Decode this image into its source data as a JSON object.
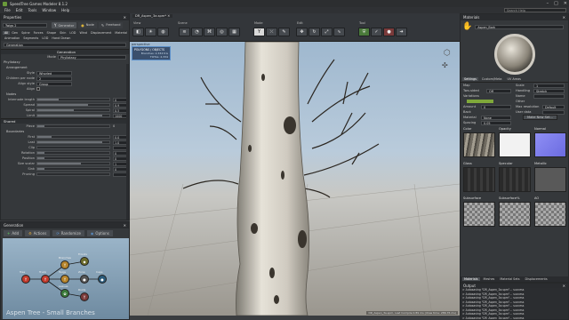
{
  "window": {
    "title": "SpeedTree Games Modeler 8.1.2",
    "controls": [
      "–",
      "□",
      "✕"
    ]
  },
  "menu": [
    "File",
    "Edit",
    "Tools",
    "Window",
    "Help"
  ],
  "help_search": {
    "placeholder": "Search Help"
  },
  "properties": {
    "title": "Properties",
    "node_field": "Twigs 2",
    "mode_tabs": [
      "Generator",
      "Node",
      "Freehand"
    ],
    "tabs_row1": [
      "Gen",
      "Spine",
      "Forces",
      "Shape",
      "Skin",
      "LOD",
      "Wind",
      "Displacement",
      "Material"
    ],
    "tabs_row2": [
      "Animation",
      "Segments",
      "LOD",
      "Hand Drawn"
    ],
    "tab_all": "All",
    "generation_field": "Generation",
    "section_generation": "Generation",
    "mode": {
      "label": "Mode",
      "value": "Phyllotaxy"
    },
    "phyllotaxy_label": "Phyllotaxy",
    "arrangement_label": "Arrangement",
    "style": {
      "label": "Style",
      "value": "Whorled"
    },
    "children_per_node": {
      "label": "Children per node",
      "value": "2"
    },
    "align_style": {
      "label": "Align style",
      "value": "Group"
    },
    "align": {
      "label": "Align"
    },
    "nodes_label": "Nodes",
    "nodes": [
      {
        "label": "Internode length",
        "value": "0",
        "fill": 0.3
      },
      {
        "label": "Spread",
        "value": "0.9",
        "fill": 0.7
      },
      {
        "label": "Spiral",
        "value": "0.5",
        "fill": 0.5
      },
      {
        "label": "Limit",
        "value": "1000",
        "fill": 0.9
      }
    ],
    "shared_label": "Shared",
    "piece": {
      "label": "Piece",
      "value": "0"
    },
    "boundaries_label": "Boundaries",
    "boundaries": [
      {
        "label": "First",
        "value": "0.0",
        "fill": 0.2
      },
      {
        "label": "Last",
        "value": "1.0",
        "fill": 0.9
      },
      {
        "label": "Clip",
        "value": "",
        "fill": 0.0
      }
    ],
    "misc": [
      {
        "label": "Rotation",
        "value": "0",
        "fill": 0.1
      },
      {
        "label": "Position",
        "value": "0",
        "fill": 0.1
      },
      {
        "label": "Size scalar",
        "value": "1",
        "fill": 0.6
      },
      {
        "label": "Sink",
        "value": "0",
        "fill": 0.1
      },
      {
        "label": "Pruning",
        "value": "",
        "fill": 0.0
      }
    ]
  },
  "generation_panel": {
    "title": "Generation",
    "buttons": [
      "Add",
      "Actions",
      "Randomize",
      "Options"
    ],
    "caption": "Aspen Tree - Small Branches",
    "nodes": [
      {
        "label": "Tree",
        "icon": "Y",
        "color": "#c0392b"
      },
      {
        "label": "Trunk",
        "icon": "Y",
        "color": "#c0392b"
      },
      {
        "label": "Branches",
        "icon": "Y",
        "color": "#b5832a"
      },
      {
        "label": "Twigs",
        "icon": "Y",
        "color": "#b5832a"
      },
      {
        "label": "Leaves",
        "icon": "✿",
        "color": "#3a7a3a"
      },
      {
        "label": "Fronds",
        "icon": "◆",
        "color": "#6a6a2a"
      },
      {
        "label": "Zone",
        "icon": "●",
        "color": "#555"
      },
      {
        "label": "Roots",
        "icon": "Y",
        "color": "#7a3a3a"
      },
      {
        "label": "Caps",
        "icon": "●",
        "color": "#2a5a7a"
      }
    ]
  },
  "toolbar": {
    "groups": [
      "View",
      "Scene",
      "Mode",
      "Edit",
      "Tool"
    ],
    "tab_name": "DR_Aspen_3a.spm*"
  },
  "viewport": {
    "label": "perspective",
    "stats_title": "POLYGONS / OBJECTS",
    "stats_lines": [
      "Branches: 2,334 tris",
      "TOTAL: 2,334"
    ],
    "status": "DR_Aspen_3a.spm, Last Compile 0.89 ms (draw time: 286.76 ms)"
  },
  "materials": {
    "title": "Materials",
    "selected": "Aspen_Bark",
    "tabs": [
      "Settings",
      "Custom/Meta",
      "UV Areas"
    ],
    "map_label": "Map",
    "two_sided": {
      "label": "Two-sided",
      "value": "Off"
    },
    "variations_label": "Variations",
    "amount": {
      "label": "Amount",
      "value": "0"
    },
    "back_label": "Back",
    "material": {
      "label": "Material",
      "value": "None"
    },
    "spacing": {
      "label": "Spacing",
      "value": "0.05"
    },
    "uv_scale": {
      "label": "Scale",
      "value": "1"
    },
    "handling": {
      "label": "Handling",
      "value": "Stretch"
    },
    "name": {
      "label": "Name",
      "value": ""
    },
    "other_label": "Other",
    "max_res": {
      "label": "Max resolution",
      "value": "Default"
    },
    "user_data": {
      "label": "User data",
      "value": ""
    },
    "make_new_button": "Make New Set...",
    "channels": [
      {
        "label": "Color",
        "kind": "bark"
      },
      {
        "label": "Opacity",
        "kind": "white"
      },
      {
        "label": "Normal",
        "kind": "normal"
      },
      {
        "label": "Gloss",
        "kind": "dark"
      },
      {
        "label": "Specular",
        "kind": "dark"
      },
      {
        "label": "Metallic",
        "kind": "gray"
      },
      {
        "label": "Subsurface",
        "kind": "checker"
      },
      {
        "label": "Subsurface%",
        "kind": "checker"
      },
      {
        "label": "AO",
        "kind": "checker"
      }
    ],
    "bottom_tabs": [
      "Materials",
      "Meshes",
      "Material Sets",
      "Displacements"
    ]
  },
  "output": {
    "title": "Output",
    "lines": [
      "> Autosaving \"DR_Aspen_3a.spm\"... success",
      "> Autosaving \"DR_Aspen_3a.spm\"... success",
      "> Autosaving \"DR_Aspen_3a.spm\"... success",
      "> Autosaving \"DR_Aspen_3a.spm\"... success",
      "> Autosaving \"DR_Aspen_3a.spm\"... success",
      "> Autosaving \"DR_Aspen_3a.spm\"... success",
      "> Autosaving \"DR_Aspen_3a.spm\"... success",
      "> Autosaving \"DR_Aspen_3a.spm\"... success"
    ]
  },
  "colors": {
    "accent": "#5b8fc9",
    "panel": "#35383b",
    "header": "#2a2c2f"
  }
}
